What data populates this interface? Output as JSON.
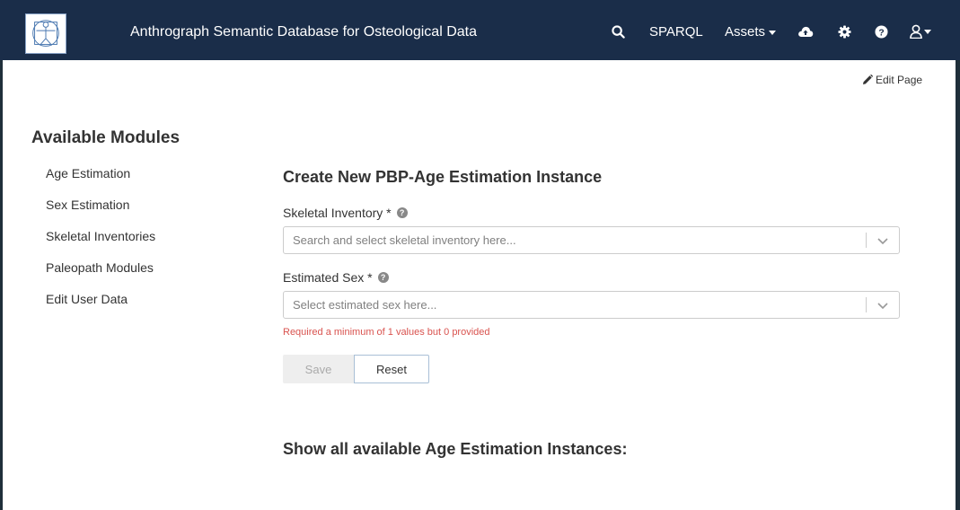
{
  "header": {
    "brand": "Anthrograph Semantic Database for Osteological Data",
    "nav": {
      "sparql": "SPARQL",
      "assets": "Assets"
    },
    "icons": [
      "search-icon",
      "cloud-upload-icon",
      "gear-icon",
      "help-icon",
      "user-icon"
    ]
  },
  "page": {
    "edit_page": "Edit Page"
  },
  "sidebar": {
    "title": "Available Modules",
    "items": [
      {
        "label": "Age Estimation"
      },
      {
        "label": "Sex Estimation"
      },
      {
        "label": "Skeletal Inventories"
      },
      {
        "label": "Paleopath Modules"
      },
      {
        "label": "Edit User Data"
      }
    ]
  },
  "form": {
    "title": "Create New PBP-Age Estimation Instance",
    "fields": [
      {
        "label": "Skeletal Inventory *",
        "placeholder": "Search and select skeletal inventory here..."
      },
      {
        "label": "Estimated Sex *",
        "placeholder": "Select estimated sex here..."
      }
    ],
    "error": "Required a minimum of 1 values but 0 provided",
    "save_label": "Save",
    "reset_label": "Reset"
  },
  "section": {
    "title": "Show all available Age Estimation Instances:"
  },
  "colors": {
    "navbar": "#1a2d49",
    "error": "#d9534f",
    "disabled_button": "#eeeeee"
  }
}
